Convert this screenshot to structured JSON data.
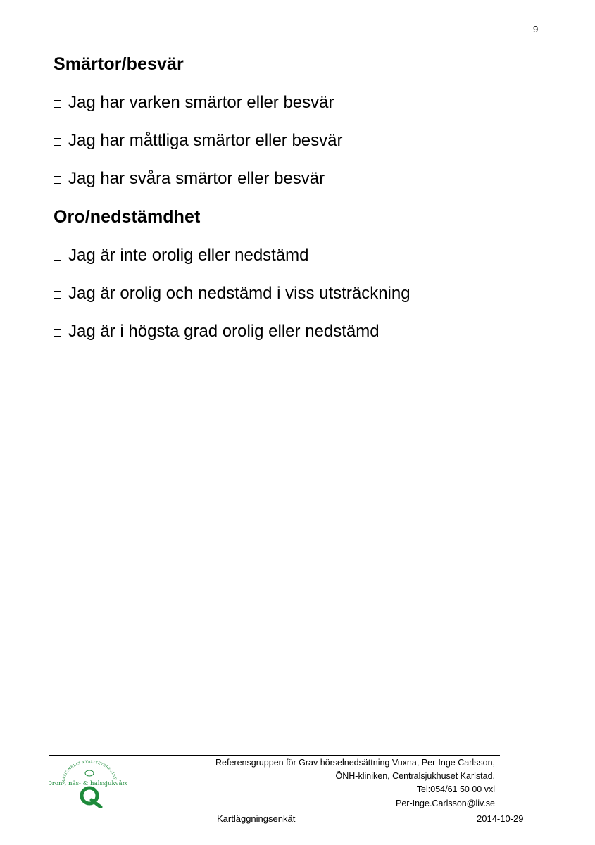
{
  "page_number": "9",
  "sections": [
    {
      "heading": "Smärtor/besvär",
      "options": [
        "Jag har varken smärtor eller besvär",
        "Jag har måttliga smärtor eller besvär",
        "Jag har svåra smärtor eller besvär"
      ]
    },
    {
      "heading": "Oro/nedstämdhet",
      "options": [
        "Jag är inte orolig eller nedstämd",
        "Jag är orolig och nedstämd i viss utsträckning",
        "Jag är i högsta grad orolig eller nedstämd"
      ]
    }
  ],
  "footer": {
    "logo": {
      "arc_text": "NATIONELLT KVALITETSREGISTER",
      "subtitle": "Öron-, näs- & halssjukvård",
      "letter": "Q",
      "color": "#1d8a3a"
    },
    "contact_lines": [
      "Referensgruppen för Grav hörselnedsättning Vuxna, Per-Inge Carlsson,",
      "ÖNH-kliniken, Centralsjukhuset Karlstad,",
      "Tel:054/61 50 00 vxl",
      "Per-Inge.Carlsson@liv.se"
    ],
    "document_title": "Kartläggningsenkät",
    "date": "2014-10-29"
  }
}
